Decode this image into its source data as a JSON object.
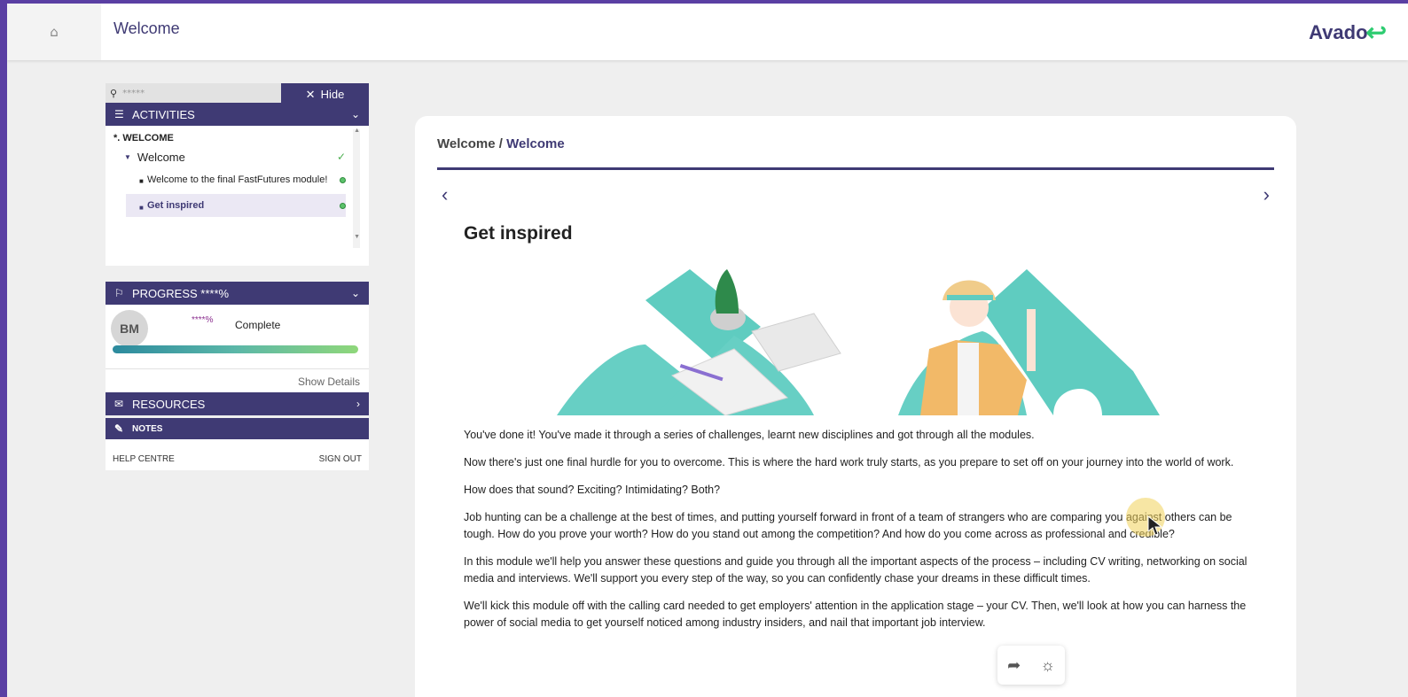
{
  "header": {
    "home_icon": "home-icon",
    "title": "Welcome",
    "logo_text": "Avado",
    "accent_color": "#3f3a74"
  },
  "sidebar": {
    "search_placeholder": "*****",
    "hide_label": "Hide",
    "activities": {
      "title": "ACTIVITIES",
      "section": "*. WELCOME",
      "parent": "Welcome",
      "items": [
        {
          "label": "Welcome to the final FastFutures module!",
          "state": "complete"
        },
        {
          "label": "Get inspired",
          "state": "active"
        }
      ]
    },
    "progress": {
      "title": "PROGRESS ****%",
      "initials": "BM",
      "percent": "****%",
      "status": "Complete",
      "show_details": "Show Details"
    },
    "resources": "RESOURCES",
    "notes": "NOTES",
    "help": "HELP CENTRE",
    "sign_out": "SIGN OUT"
  },
  "content": {
    "breadcrumb_parent": "Welcome",
    "breadcrumb_sep": " / ",
    "breadcrumb_current": "Welcome",
    "heading": "Get inspired",
    "paragraphs": [
      "You've done it! You've made it through a series of challenges, learnt new disciplines and got through all the modules.",
      "Now there's just one final hurdle for you to overcome. This is where the hard work truly starts, as you prepare to set off on your journey into the world of work.",
      "How does that sound? Exciting? Intimidating? Both?",
      "Job hunting can be a challenge at the best of times, and putting yourself forward in front of a team of strangers who are comparing you against others can be tough. How do you prove your worth? How do you stand out among the competition? And how do you come across as professional and credible?",
      "In this module we'll help you answer these questions and guide you through all the important aspects of the process – including CV writing, networking on social media and interviews. We'll support you every step of the way, so you can confidently chase your dreams in these difficult times.",
      "We'll kick this module off with the calling card needed to get employers' attention in the application stage – your CV. Then, we'll look at how you can harness the power of social media to get yourself noticed among industry insiders, and nail that important job interview."
    ]
  }
}
